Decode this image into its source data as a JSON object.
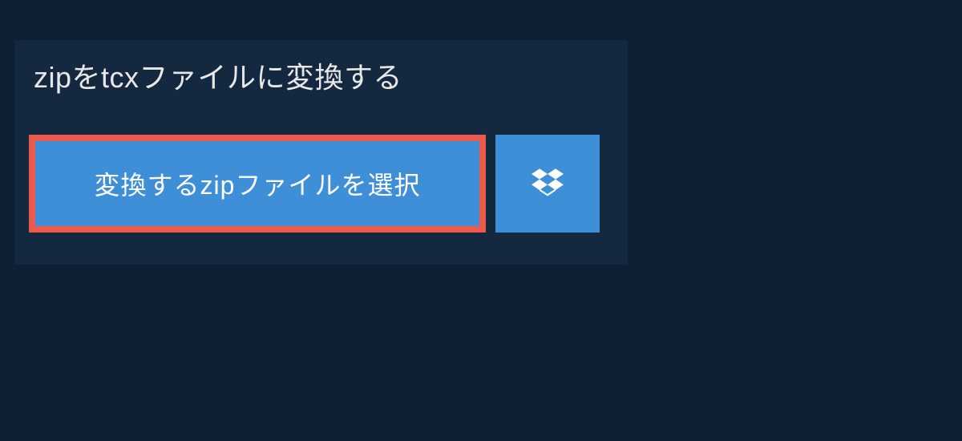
{
  "heading": {
    "text": "zipをtcxファイルに変換する"
  },
  "buttons": {
    "select_label": "変換するzipファイルを選択",
    "dropbox_icon_name": "dropbox-icon"
  },
  "colors": {
    "page_bg": "#0e1f33",
    "panel_bg": "#14293f",
    "button_bg": "#3f8ed8",
    "button_border": "#eb5a4a",
    "text_light": "#e8e8e8",
    "text_white": "#ffffff"
  }
}
